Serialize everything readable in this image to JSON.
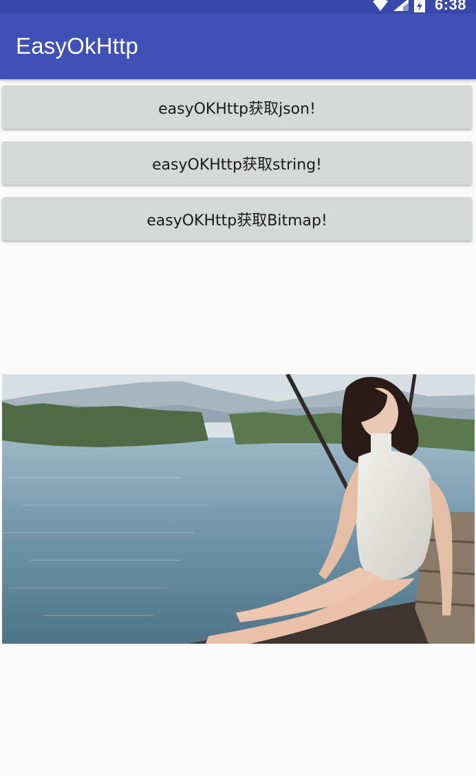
{
  "status_bar": {
    "time": "6:38",
    "icons": [
      "wifi-icon",
      "cell-signal-icon",
      "battery-icon"
    ],
    "color": "#3949ab"
  },
  "app_bar": {
    "title": "EasyOkHttp",
    "color": "#3f51b5"
  },
  "buttons": [
    {
      "label": "easyOKHttp获取json!"
    },
    {
      "label": "easyOKHttp获取string!"
    },
    {
      "label": "easyOKHttp获取Bitmap!"
    }
  ],
  "image": {
    "description_icon": "photo-image",
    "palette": {
      "sky": "#dfe6ea",
      "mountains": "#9fb0bb",
      "reeds": "#4e6b45",
      "water": "#7fa0b2",
      "dock": "#4a3f36"
    }
  }
}
